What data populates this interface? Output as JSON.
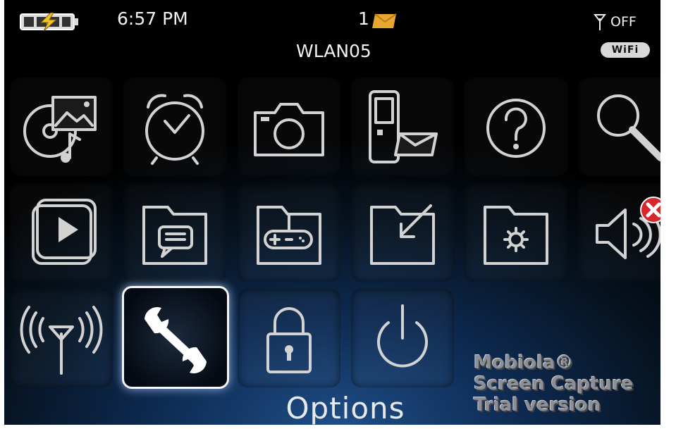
{
  "status_bar": {
    "time": "6:57 PM",
    "message_count": "1",
    "network_name": "WLAN05",
    "radio_state": "OFF",
    "wifi_badge": "WiFi",
    "battery_icon": "battery-charging-icon",
    "envelope_color": "#e8a631",
    "battery_bolt_color": "#f3c326"
  },
  "home_screen": {
    "selected_label": "Options",
    "apps": [
      {
        "name": "media",
        "icon": "media-icon"
      },
      {
        "name": "clock",
        "icon": "alarm-clock-icon"
      },
      {
        "name": "camera",
        "icon": "camera-icon"
      },
      {
        "name": "messenger",
        "icon": "phone-message-icon"
      },
      {
        "name": "help",
        "icon": "help-icon"
      },
      {
        "name": "search",
        "icon": "search-icon"
      },
      {
        "name": "videos",
        "icon": "video-play-icon"
      },
      {
        "name": "messages-folder",
        "icon": "chat-folder-icon"
      },
      {
        "name": "games-folder",
        "icon": "game-folder-icon"
      },
      {
        "name": "downloads-folder",
        "icon": "download-folder-icon"
      },
      {
        "name": "settings-folder",
        "icon": "settings-folder-icon"
      },
      {
        "name": "sound-profile",
        "icon": "speaker-muted-icon"
      },
      {
        "name": "manage-connections",
        "icon": "antenna-icon"
      },
      {
        "name": "options",
        "icon": "wrench-icon"
      },
      {
        "name": "lock",
        "icon": "padlock-icon"
      },
      {
        "name": "power",
        "icon": "power-icon"
      }
    ]
  },
  "watermark": {
    "line1": "Mobiola®",
    "line2": "Screen Capture",
    "line3": "Trial version"
  }
}
